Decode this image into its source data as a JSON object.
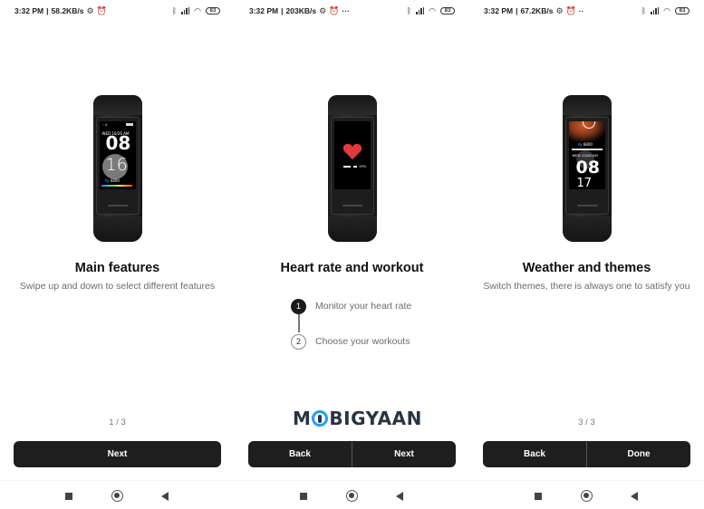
{
  "screens": [
    {
      "status": {
        "time": "3:32 PM",
        "speed": "58.2KB/s",
        "battery": "83",
        "overflow": ""
      },
      "band": {
        "face": "main",
        "date": "WED 10/26 AM",
        "hour": "08",
        "minute": "16",
        "steps": "6800"
      },
      "title": "Main features",
      "subtitle": "Swipe up and down to select different features",
      "pager": "1 / 3",
      "buttons": [
        "Next"
      ]
    },
    {
      "status": {
        "time": "3:32 PM",
        "speed": "203KB/s",
        "battery": "83",
        "overflow": "···"
      },
      "band": {
        "face": "heart",
        "bpm": "BPM"
      },
      "title": "Heart rate and workout",
      "steps": [
        {
          "num": "1",
          "label": "Monitor your heart rate",
          "active": true
        },
        {
          "num": "2",
          "label": "Choose your workouts",
          "active": false
        }
      ],
      "pager": "",
      "buttons": [
        "Back",
        "Next"
      ]
    },
    {
      "status": {
        "time": "3:32 PM",
        "speed": "67.2KB/s",
        "battery": "83",
        "overflow": "··"
      },
      "band": {
        "face": "theme",
        "date": "WED 10/26 AM",
        "hour": "08",
        "minute": "17",
        "steps": "6800"
      },
      "title": "Weather and themes",
      "subtitle": "Switch themes, there is always one to satisfy you",
      "pager": "3 / 3",
      "buttons": [
        "Back",
        "Done"
      ]
    }
  ],
  "icons": {
    "bluetooth": "bluetooth-icon",
    "signal": "signal-icon",
    "wifi": "wifi-icon",
    "alarm": "alarm-icon",
    "settings": "settings-icon",
    "nav_recents": "recents-icon",
    "nav_home": "home-icon",
    "nav_back": "back-icon"
  },
  "watermark": {
    "text_before": "M",
    "text_after": "BIGYAAN"
  },
  "colors": {
    "button_bg": "#1e1e1e",
    "heart": "#e03a3e",
    "watermark_blue": "#1da1f2"
  }
}
